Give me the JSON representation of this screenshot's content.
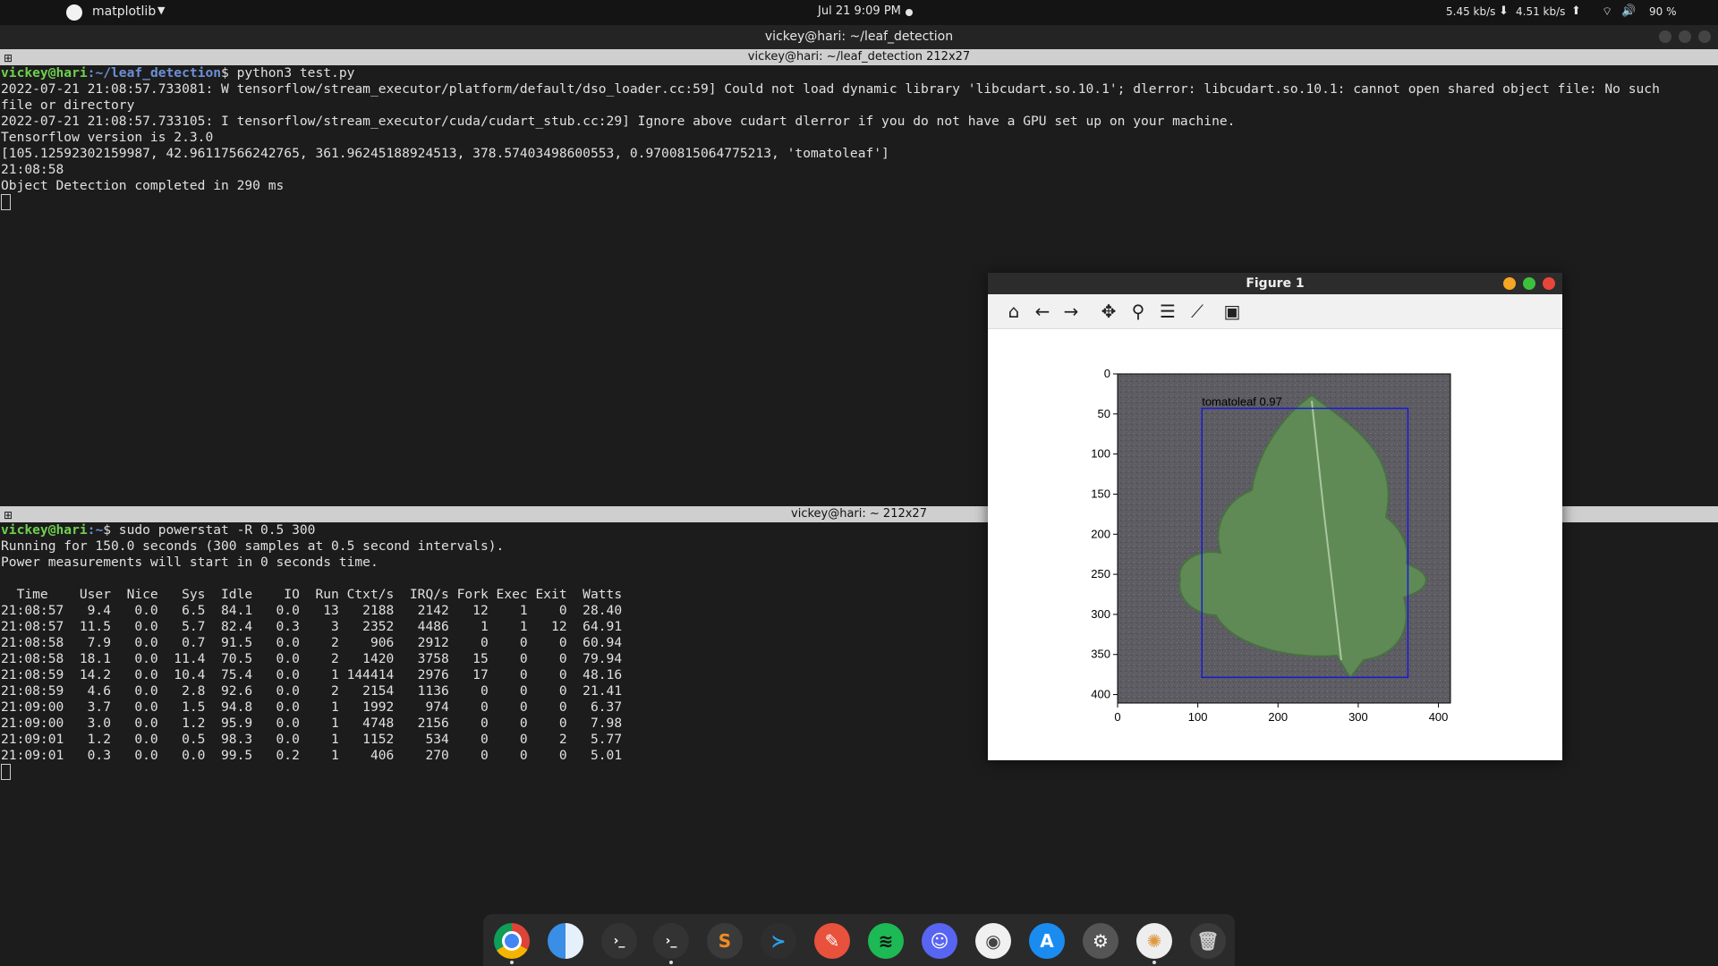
{
  "topbar": {
    "app_name": "matplotlib",
    "clock": "Jul 21  9:09 PM",
    "net_down": "5.45 kb/s",
    "net_up": "4.51 kb/s",
    "battery": "90 %"
  },
  "window": {
    "title": "vickey@hari: ~/leaf_detection"
  },
  "pane_top": {
    "header": "vickey@hari: ~/leaf_detection 212x27",
    "prompt_user": "vickey@hari",
    "prompt_path": ":~/leaf_detection",
    "command": "$ python3 test.py",
    "lines": [
      "2022-07-21 21:08:57.733081: W tensorflow/stream_executor/platform/default/dso_loader.cc:59] Could not load dynamic library 'libcudart.so.10.1'; dlerror: libcudart.so.10.1: cannot open shared object file: No such",
      "file or directory",
      "2022-07-21 21:08:57.733105: I tensorflow/stream_executor/cuda/cudart_stub.cc:29] Ignore above cudart dlerror if you do not have a GPU set up on your machine.",
      "Tensorflow version is 2.3.0",
      "[105.12592302159987, 42.96117566242765, 361.96245188924513, 378.57403498600553, 0.9700815064775213, 'tomatoleaf']",
      "21:08:58",
      "Object Detection completed in 290 ms"
    ]
  },
  "pane_bottom": {
    "header": "vickey@hari: ~ 212x27",
    "prompt_user": "vickey@hari",
    "prompt_path": ":~",
    "command": "$ sudo powerstat -R 0.5 300",
    "lines": [
      "Running for 150.0 seconds (300 samples at 0.5 second intervals).",
      "Power measurements will start in 0 seconds time.",
      "",
      "  Time    User  Nice   Sys  Idle    IO  Run Ctxt/s  IRQ/s Fork Exec Exit  Watts",
      "21:08:57   9.4   0.0   6.5  84.1   0.0   13   2188   2142   12    1    0  28.40",
      "21:08:57  11.5   0.0   5.7  82.4   0.3    3   2352   4486    1    1   12  64.91",
      "21:08:58   7.9   0.0   0.7  91.5   0.0    2    906   2912    0    0    0  60.94",
      "21:08:58  18.1   0.0  11.4  70.5   0.0    2   1420   3758   15    0    0  79.94",
      "21:08:59  14.2   0.0  10.4  75.4   0.0    1 144414   2976   17    0    0  48.16",
      "21:08:59   4.6   0.0   2.8  92.6   0.0    2   2154   1136    0    0    0  21.41",
      "21:09:00   3.7   0.0   1.5  94.8   0.0    1   1992    974    0    0    0   6.37",
      "21:09:00   3.0   0.0   1.2  95.9   0.0    1   4748   2156    0    0    0   7.98",
      "21:09:01   1.2   0.0   0.5  98.3   0.0    1   1152    534    0    0    2   5.77",
      "21:09:01   0.3   0.0   0.0  99.5   0.2    1    406    270    0    0    0   5.01"
    ]
  },
  "figure": {
    "title": "Figure 1",
    "detection_label": "tomatoleaf 0.97",
    "y_ticks": [
      "0",
      "50",
      "100",
      "150",
      "200",
      "250",
      "300",
      "350",
      "400"
    ],
    "x_ticks": [
      "0",
      "100",
      "200",
      "300",
      "400"
    ]
  },
  "dock": {
    "items": [
      "chrome-icon",
      "finder-icon",
      "terminal-icon",
      "terminal-icon",
      "sublime-icon",
      "vscode-icon",
      "pencil-icon",
      "spotify-icon",
      "discord-icon",
      "camera-icon",
      "appstore-icon",
      "settings-icon",
      "matplotlib-icon",
      "trash-icon"
    ]
  },
  "colors": {
    "accent_user": "#6fd04e",
    "accent_path": "#6c8fd6",
    "bbox": "#1a1ad6"
  }
}
